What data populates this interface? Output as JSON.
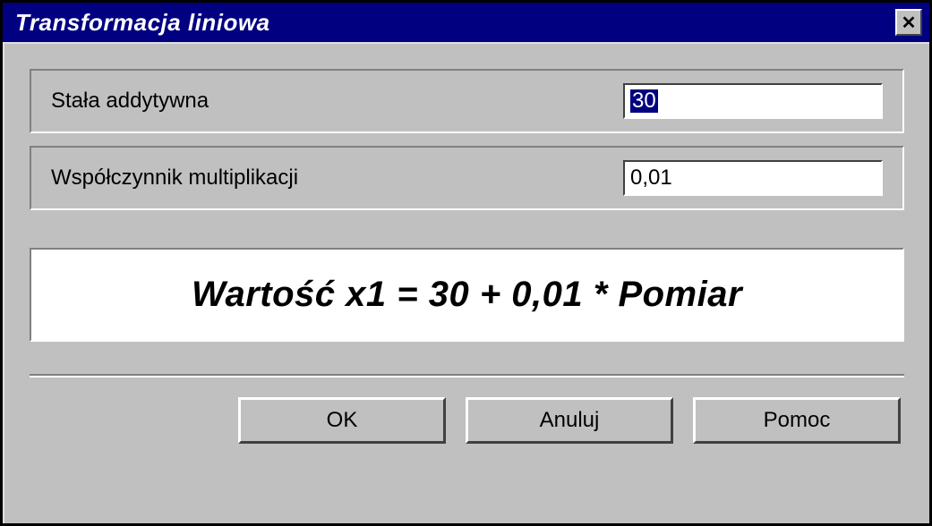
{
  "window": {
    "title": "Transformacja liniowa",
    "close_label": "✕"
  },
  "fields": {
    "additive": {
      "label": "Stała addytywna",
      "value": "30"
    },
    "multiplier": {
      "label": "Współczynnik multiplikacji",
      "value": "0,01"
    }
  },
  "formula": "Wartość x1 = 30 + 0,01 * Pomiar",
  "buttons": {
    "ok": "OK",
    "cancel": "Anuluj",
    "help": "Pomoc"
  }
}
